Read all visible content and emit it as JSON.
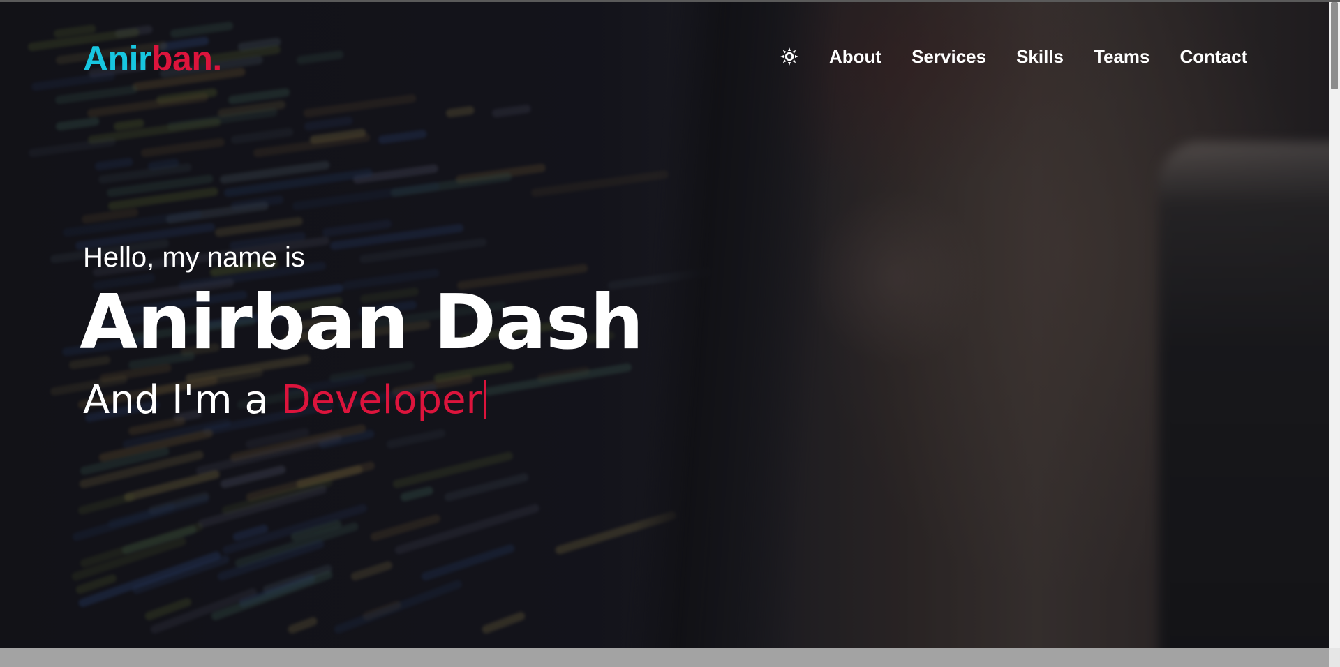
{
  "brand": {
    "part1": "Anir",
    "part2": "ban",
    "dot": ".",
    "color_primary": "#17c6e0",
    "color_accent": "#dc143c"
  },
  "navbar": {
    "theme_icon": "sun-icon",
    "links": [
      "About",
      "Services",
      "Skills",
      "Teams",
      "Contact"
    ]
  },
  "hero": {
    "intro": "Hello, my name is",
    "name": "Anirban Dash",
    "role_prefix": "And I'm a ",
    "role_typed": "Developer",
    "accent_color": "#dc143c"
  }
}
